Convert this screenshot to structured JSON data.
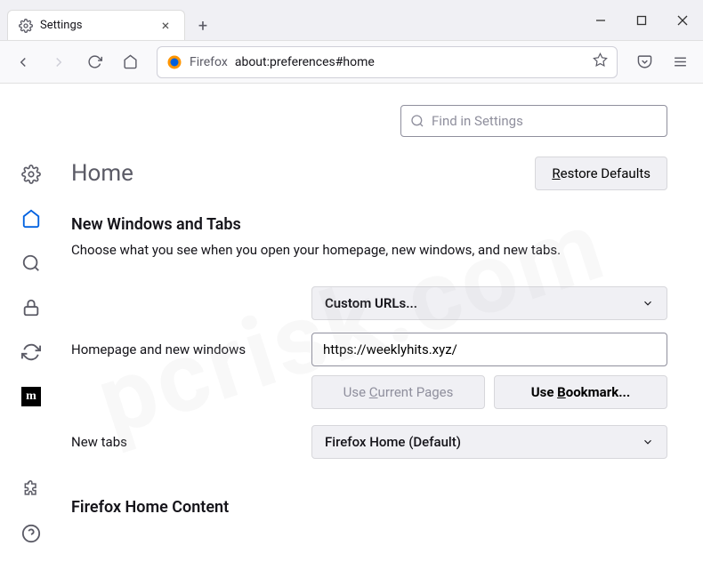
{
  "tab": {
    "title": "Settings"
  },
  "urlbar": {
    "product": "Firefox",
    "address": "about:preferences#home"
  },
  "search": {
    "placeholder": "Find in Settings"
  },
  "page": {
    "title": "Home",
    "restore_label": "Restore Defaults",
    "section1_heading": "New Windows and Tabs",
    "section1_desc": "Choose what you see when you open your homepage, new windows, and new tabs.",
    "homepage_label": "Homepage and new windows",
    "homepage_select": "Custom URLs...",
    "homepage_value": "https://weeklyhits.xyz/",
    "use_current": "Use Current Pages",
    "use_bookmark": "Use Bookmark...",
    "newtabs_label": "New tabs",
    "newtabs_select": "Firefox Home (Default)",
    "section2_heading": "Firefox Home Content"
  }
}
